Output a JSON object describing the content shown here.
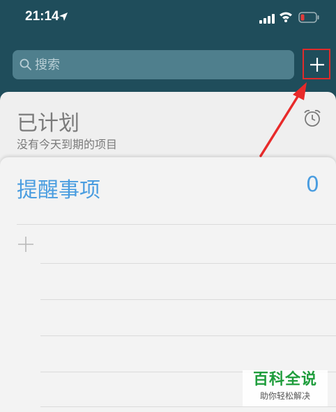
{
  "status_bar": {
    "time": "21:14",
    "icons": [
      "location-arrow-icon",
      "signal-icon",
      "wifi-icon",
      "battery-low-icon"
    ]
  },
  "search": {
    "placeholder": "搜索",
    "value": ""
  },
  "toolbar": {
    "add_icon": "plus-icon",
    "highlight_color": "#e02b2b"
  },
  "planned": {
    "title": "已计划",
    "subtitle": "没有今天到期的项目",
    "icon": "alarm-clock-icon"
  },
  "reminders": {
    "title": "提醒事项",
    "count": "0",
    "accent": "#4a9de0"
  },
  "watermark": {
    "title": "百科全说",
    "subtitle": "助你轻松解决"
  },
  "colors": {
    "background": "#1f4d5b",
    "search_bg": "#4f7f8d",
    "card_bg": "#efefef"
  }
}
